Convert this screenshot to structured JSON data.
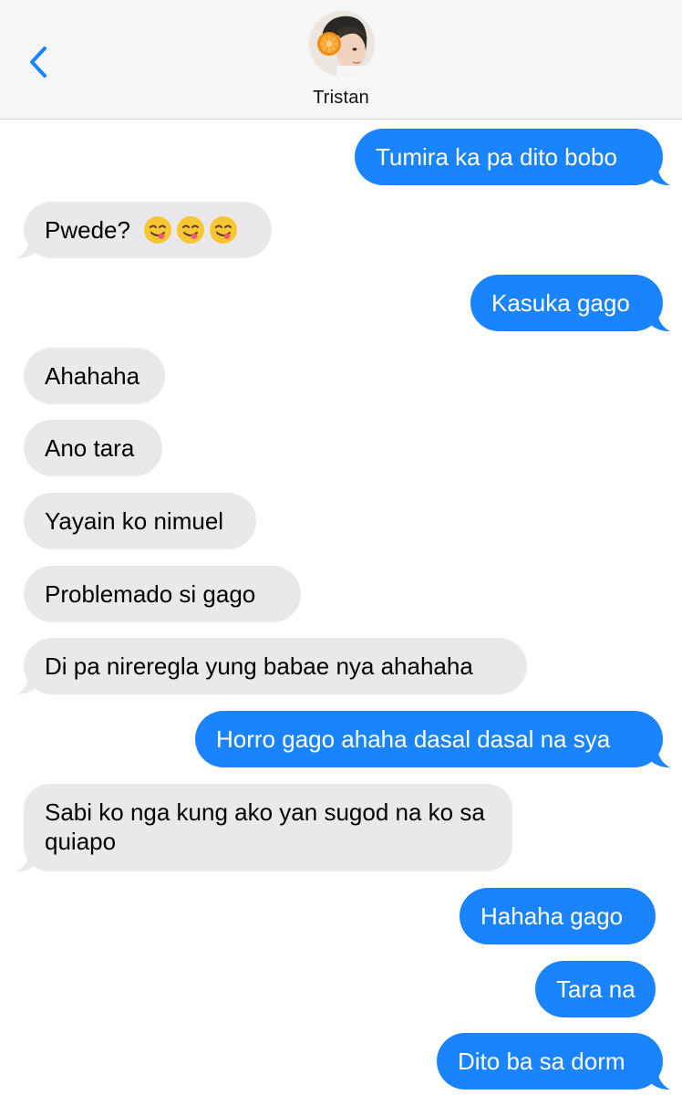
{
  "header": {
    "contact_name": "Tristan",
    "back_icon": "chevron-left-icon"
  },
  "colors": {
    "outgoing_bubble": "#1a84ff",
    "incoming_bubble": "#e9e9eb",
    "header_bg": "#f6f6f7",
    "accent": "#1a84ff"
  },
  "messages": [
    {
      "direction": "outgoing",
      "text": "Tumira ka pa dito bobo"
    },
    {
      "direction": "incoming",
      "text": "Pwede?",
      "emojis": [
        "yum-face-icon",
        "yum-face-icon",
        "yum-face-icon"
      ]
    },
    {
      "direction": "outgoing",
      "text": "Kasuka gago"
    },
    {
      "direction": "incoming",
      "text": "Ahahaha"
    },
    {
      "direction": "incoming",
      "text": "Ano tara"
    },
    {
      "direction": "incoming",
      "text": "Yayain ko nimuel"
    },
    {
      "direction": "incoming",
      "text": "Problemado si gago"
    },
    {
      "direction": "incoming",
      "text": "Di pa nireregla yung babae nya ahahaha"
    },
    {
      "direction": "outgoing",
      "text": "Horro gago ahaha dasal dasal na sya"
    },
    {
      "direction": "incoming",
      "text": "Sabi ko nga kung ako yan sugod na ko sa quiapo"
    },
    {
      "direction": "outgoing",
      "text": "Hahaha gago"
    },
    {
      "direction": "outgoing",
      "text": "Tara na"
    },
    {
      "direction": "outgoing",
      "text": "Dito ba sa dorm"
    }
  ]
}
